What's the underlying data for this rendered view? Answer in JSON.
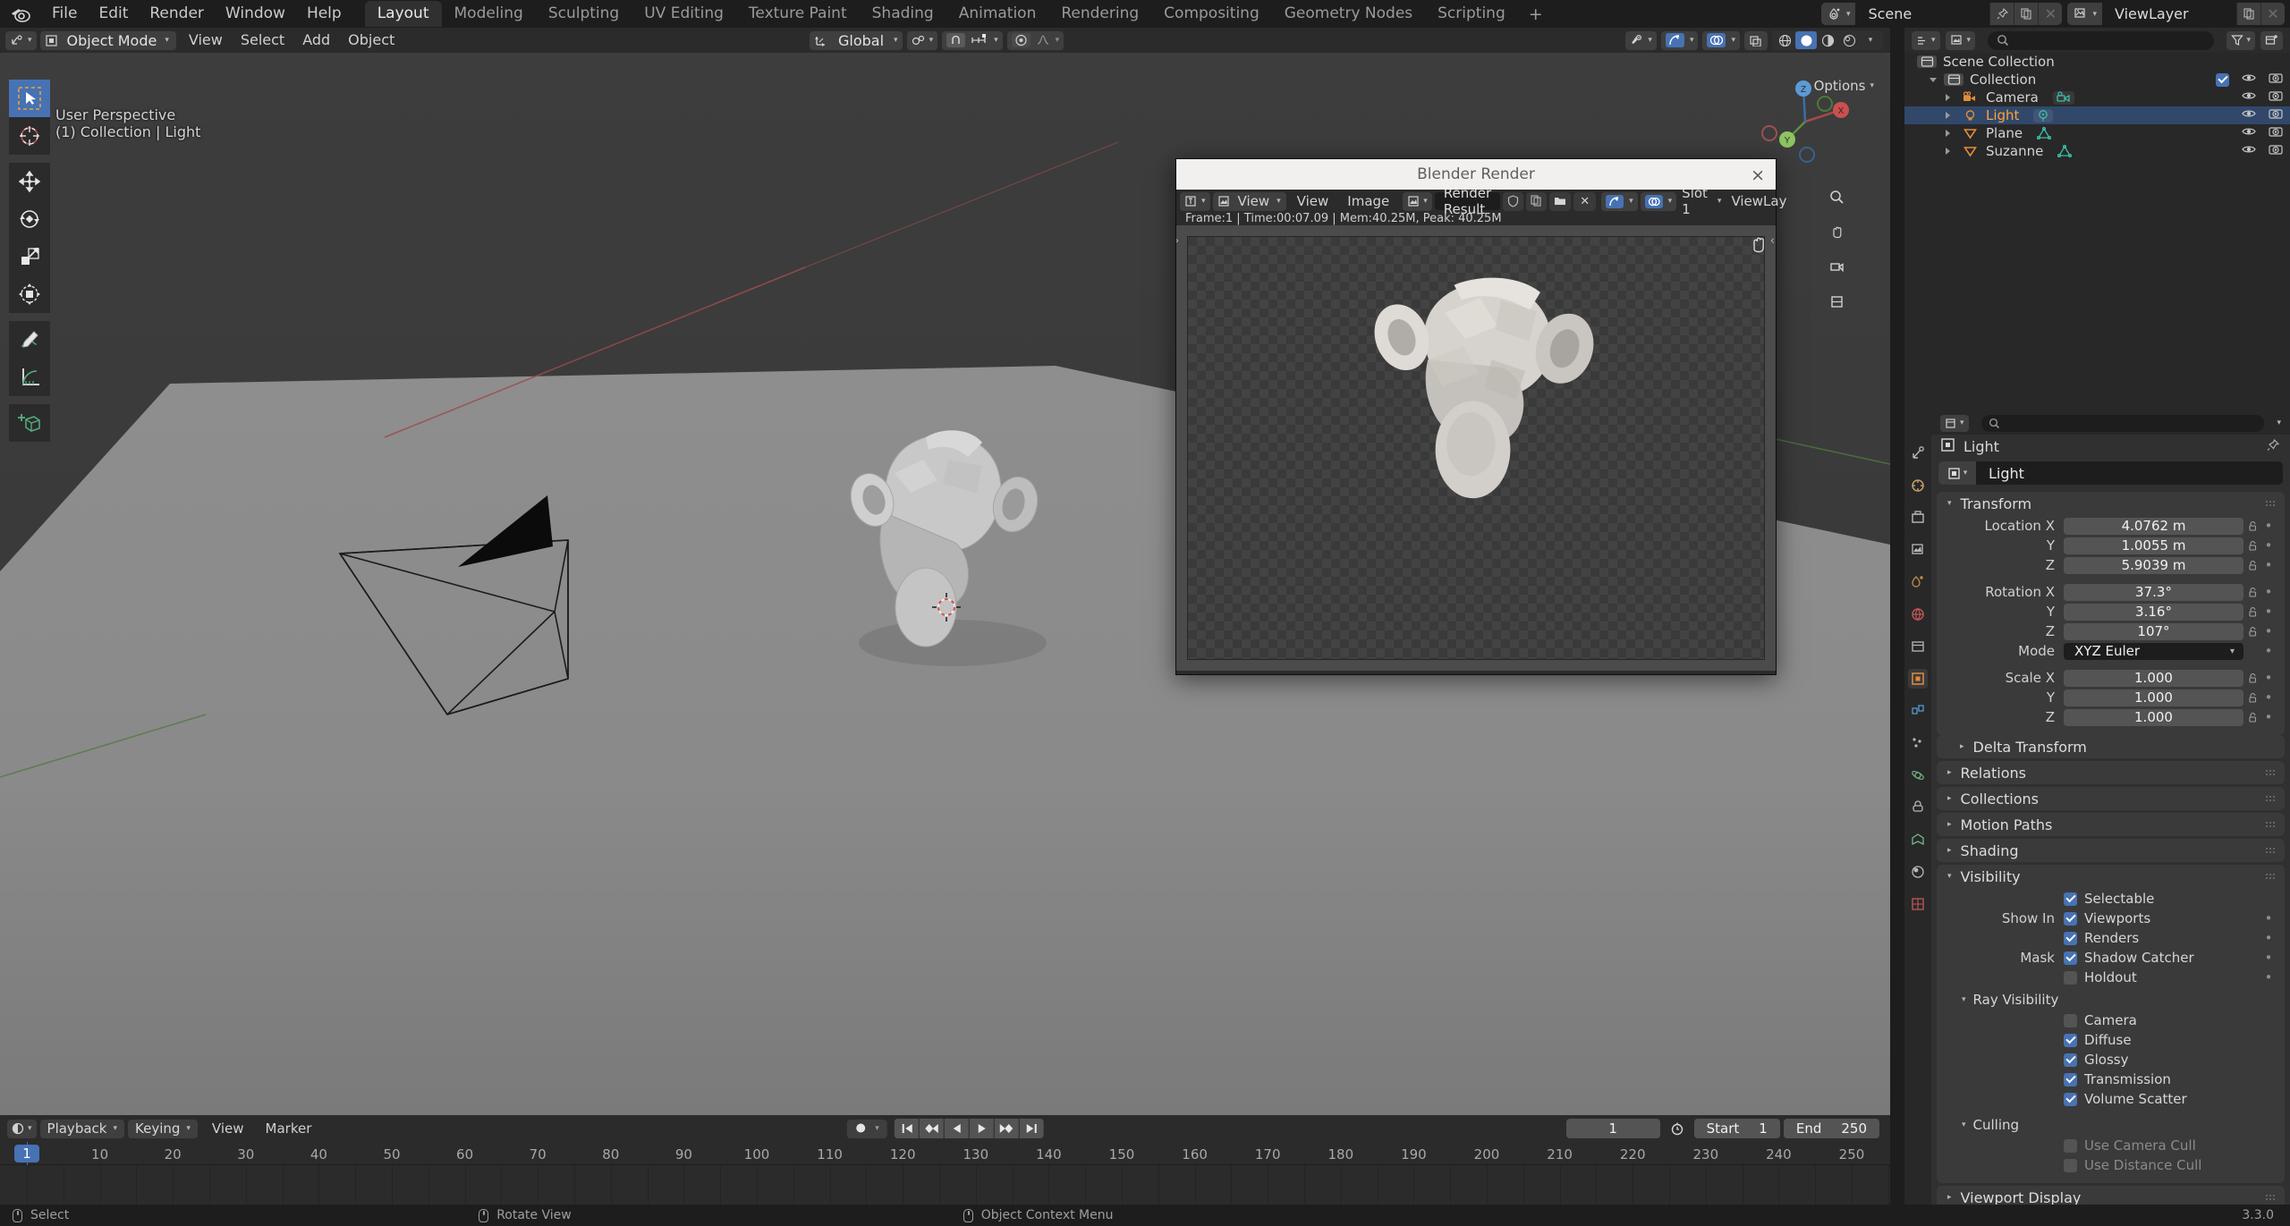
{
  "app": {
    "title": "Blender",
    "version": "3.3.0"
  },
  "topbar": {
    "menus": [
      "File",
      "Edit",
      "Render",
      "Window",
      "Help"
    ],
    "workspaces": [
      {
        "label": "Layout",
        "active": true
      },
      {
        "label": "Modeling",
        "active": false
      },
      {
        "label": "Sculpting",
        "active": false
      },
      {
        "label": "UV Editing",
        "active": false
      },
      {
        "label": "Texture Paint",
        "active": false
      },
      {
        "label": "Shading",
        "active": false
      },
      {
        "label": "Animation",
        "active": false
      },
      {
        "label": "Rendering",
        "active": false
      },
      {
        "label": "Compositing",
        "active": false
      },
      {
        "label": "Geometry Nodes",
        "active": false
      },
      {
        "label": "Scripting",
        "active": false
      }
    ],
    "add_workspace": "+",
    "scene_name": "Scene",
    "viewlayer_name": "ViewLayer"
  },
  "viewport": {
    "mode": "Object Mode",
    "menus": [
      "View",
      "Select",
      "Add",
      "Object"
    ],
    "transform_orientation": "Global",
    "overlay_label": "Options",
    "info_line1": "User Perspective",
    "info_line2": "(1) Collection | Light",
    "tools": [
      "tweak-select-tool",
      "cursor-tool",
      "move-tool",
      "rotate-tool",
      "scale-tool",
      "transform-tool",
      "annotate-tool",
      "measure-tool",
      "add-cube-tool"
    ],
    "gizmo_axes": [
      "X",
      "Y",
      "Z"
    ]
  },
  "render_window": {
    "title": "Blender Render",
    "close_label": "×",
    "menus": [
      "View",
      "Image"
    ],
    "view_dropdown": "View",
    "image_name": "Render Result",
    "slot": "Slot 1",
    "viewlayer": "ViewLay",
    "status": "Frame:1 | Time:00:07.09 | Mem:40.25M, Peak: 40.25M"
  },
  "outliner": {
    "search_placeholder": "",
    "rows": [
      {
        "label": "Scene Collection",
        "indent": 0,
        "icon": "collection-icon",
        "selected": false,
        "expander": "none",
        "show_toggles": false
      },
      {
        "label": "Collection",
        "indent": 1,
        "icon": "collection-icon",
        "selected": false,
        "expander": "down",
        "show_toggles": true,
        "checkbox": true
      },
      {
        "label": "Camera",
        "indent": 2,
        "icon": "camera-icon",
        "selected": false,
        "expander": "right",
        "show_toggles": true,
        "data_icon": "camera-data-icon"
      },
      {
        "label": "Light",
        "indent": 2,
        "icon": "light-icon",
        "selected": true,
        "expander": "right",
        "show_toggles": true,
        "data_icon": "light-data-icon"
      },
      {
        "label": "Plane",
        "indent": 2,
        "icon": "mesh-icon",
        "selected": false,
        "expander": "right",
        "show_toggles": true,
        "data_icon": "mesh-data-icon"
      },
      {
        "label": "Suzanne",
        "indent": 2,
        "icon": "mesh-icon",
        "selected": false,
        "expander": "right",
        "show_toggles": true,
        "data_icon": "mesh-data-icon"
      }
    ]
  },
  "properties": {
    "breadcrumb_object": "Light",
    "object_name": "Light",
    "transform": {
      "title": "Transform",
      "rows": [
        {
          "label": "Location X",
          "value": "4.0762 m"
        },
        {
          "label": "Y",
          "value": "1.0055 m"
        },
        {
          "label": "Z",
          "value": "5.9039 m"
        }
      ],
      "rotation": [
        {
          "label": "Rotation X",
          "value": "37.3°"
        },
        {
          "label": "Y",
          "value": "3.16°"
        },
        {
          "label": "Z",
          "value": "107°"
        }
      ],
      "mode_label": "Mode",
      "mode_value": "XYZ Euler",
      "scale": [
        {
          "label": "Scale X",
          "value": "1.000"
        },
        {
          "label": "Y",
          "value": "1.000"
        },
        {
          "label": "Z",
          "value": "1.000"
        }
      ]
    },
    "delta_transform": "Delta Transform",
    "collapsed_panels": [
      "Relations",
      "Collections",
      "Motion Paths",
      "Shading"
    ],
    "visibility": {
      "title": "Visibility",
      "rows": [
        {
          "label": "",
          "text": "Selectable",
          "checked": true,
          "dot": false
        },
        {
          "label": "Show In",
          "text": "Viewports",
          "checked": true,
          "dot": true
        },
        {
          "label": "",
          "text": "Renders",
          "checked": true,
          "dot": true
        },
        {
          "label": "Mask",
          "text": "Shadow Catcher",
          "checked": true,
          "dot": true
        },
        {
          "label": "",
          "text": "Holdout",
          "checked": false,
          "dot": true
        }
      ],
      "ray_visibility": {
        "title": "Ray Visibility",
        "rows": [
          {
            "text": "Camera",
            "checked": false
          },
          {
            "text": "Diffuse",
            "checked": true
          },
          {
            "text": "Glossy",
            "checked": true
          },
          {
            "text": "Transmission",
            "checked": true
          },
          {
            "text": "Volume Scatter",
            "checked": true
          }
        ]
      },
      "culling": {
        "title": "Culling",
        "rows": [
          {
            "text": "Use Camera Cull",
            "checked": false,
            "disabled": true
          },
          {
            "text": "Use Distance Cull",
            "checked": false,
            "disabled": true
          }
        ]
      }
    },
    "viewport_display": "Viewport Display"
  },
  "timeline": {
    "menus": [
      "Playback",
      "Keying",
      "View",
      "Marker"
    ],
    "current_frame": "1",
    "start_label": "Start",
    "start_value": "1",
    "end_label": "End",
    "end_value": "250",
    "ticks": [
      "1",
      "10",
      "20",
      "30",
      "40",
      "50",
      "60",
      "70",
      "80",
      "90",
      "100",
      "110",
      "120",
      "130",
      "140",
      "150",
      "160",
      "170",
      "180",
      "190",
      "200",
      "210",
      "220",
      "230",
      "240",
      "250"
    ],
    "playhead_frame": "1"
  },
  "statusbar": {
    "items": [
      {
        "icon": "mouse-left-icon",
        "label": "Select"
      },
      {
        "icon": "mouse-middle-icon",
        "label": "Rotate View"
      },
      {
        "icon": "mouse-right-icon",
        "label": "Object Context Menu"
      }
    ],
    "version": "3.3.0"
  },
  "colors": {
    "accent_blue": "#4772b3",
    "selected_orange": "#ffa13b",
    "window_bg": "#1d1d1d",
    "panel_bg": "#303030",
    "viewport_bg": "#393939"
  }
}
